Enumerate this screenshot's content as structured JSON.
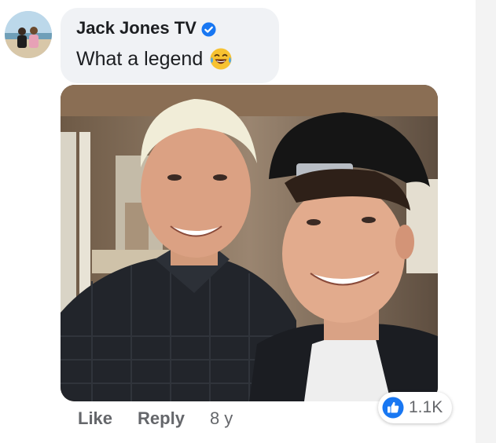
{
  "comment": {
    "author": "Jack Jones TV",
    "text": "What a legend",
    "author_verified": true,
    "emoji": "face-with-tears-of-joy-icon"
  },
  "actions": {
    "like_label": "Like",
    "reply_label": "Reply",
    "timestamp": "8 y"
  },
  "reactions": {
    "icon": "thumbs-up-icon",
    "count": "1.1K"
  },
  "colors": {
    "bubble_bg": "#f0f2f5",
    "accent_blue": "#1877f2",
    "secondary_text": "#65676b",
    "primary_text": "#1c1e21"
  }
}
